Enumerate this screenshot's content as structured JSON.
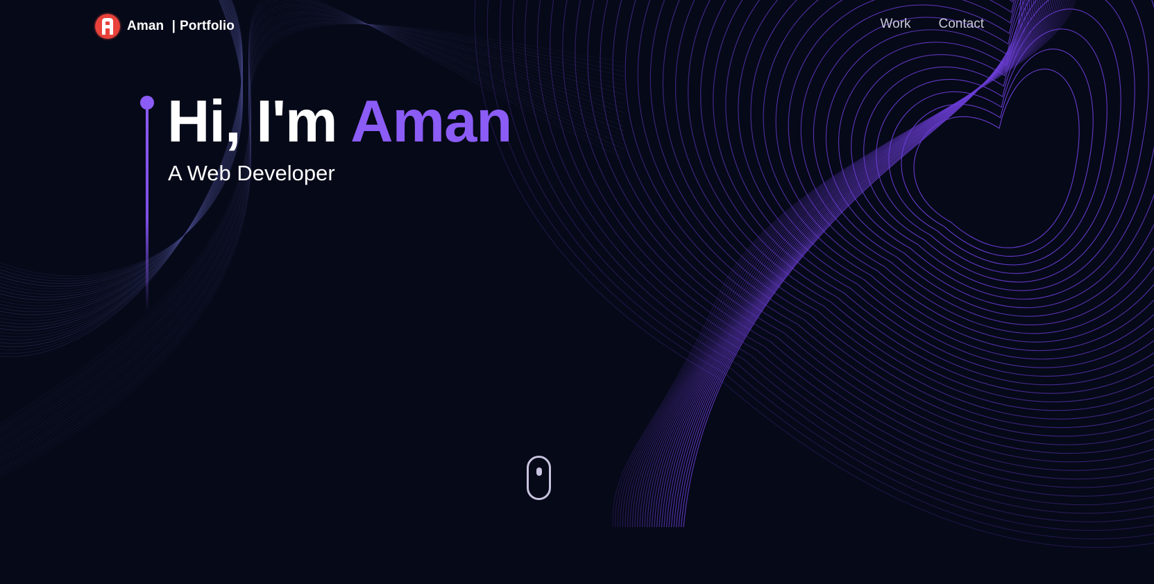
{
  "brand": {
    "logo_letter": "A",
    "logo_icon": "a-logo-icon",
    "name": "Aman",
    "separator": "|",
    "suffix": "Portfolio"
  },
  "nav": {
    "items": [
      {
        "label": "Work"
      },
      {
        "label": "Contact"
      }
    ]
  },
  "hero": {
    "greeting": "Hi, I'm",
    "name": "Aman",
    "subtitle": "A Web Developer"
  },
  "scroll": {
    "icon": "mouse-scroll-icon"
  },
  "colors": {
    "background": "#060918",
    "accent": "#8b5cf6",
    "logo": "#e8423b",
    "text": "#ffffff",
    "nav_text": "#c9c9d8"
  }
}
